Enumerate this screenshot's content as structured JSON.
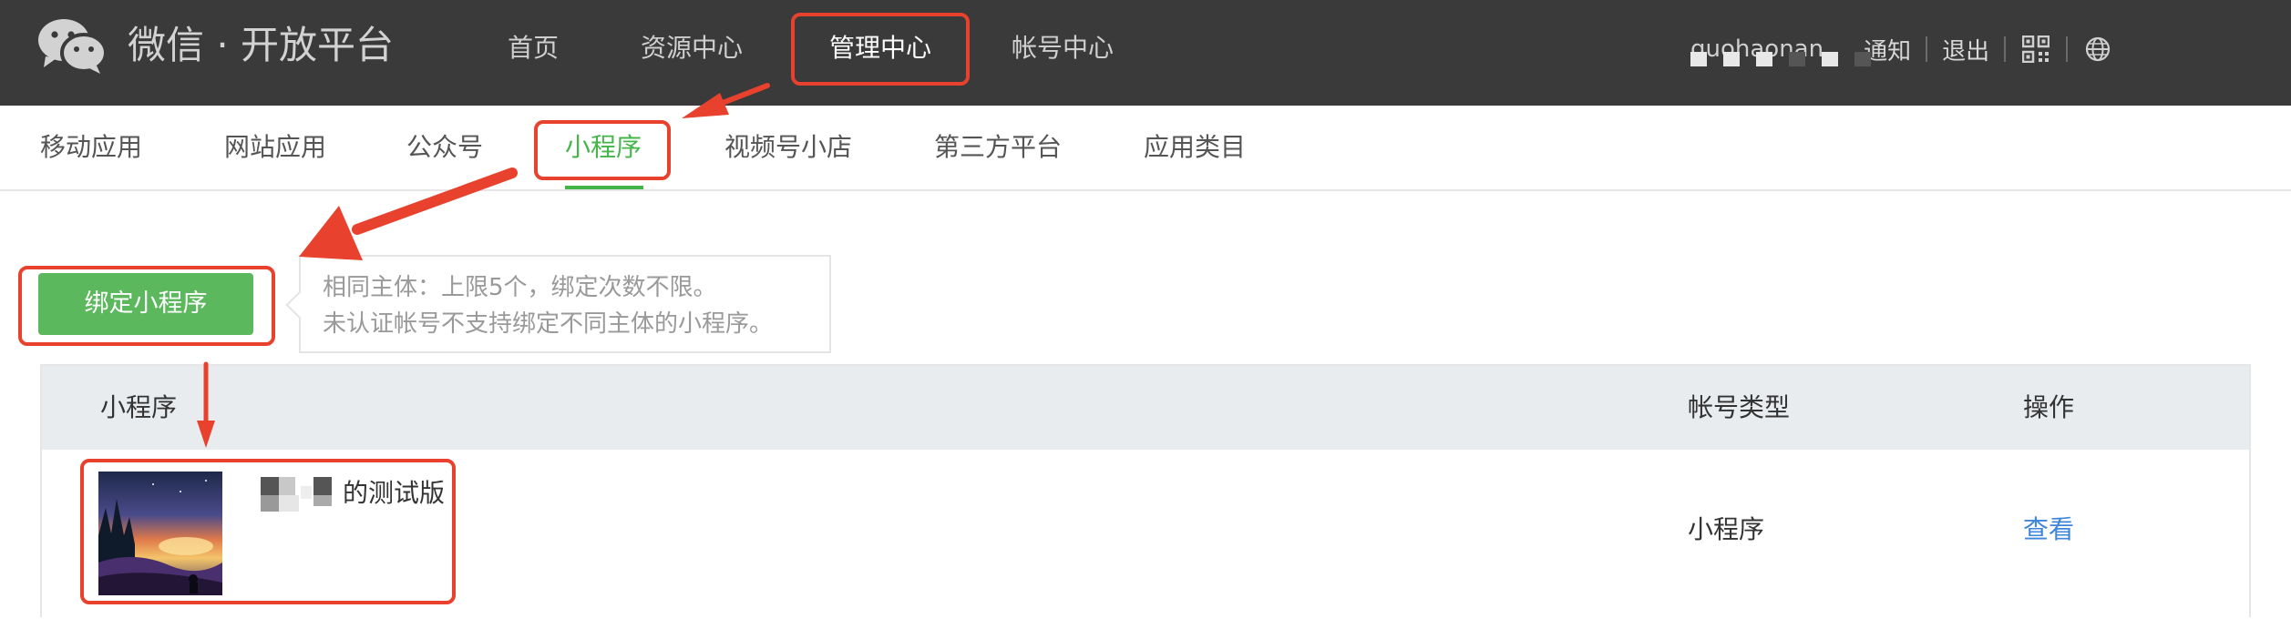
{
  "header": {
    "brand": "微信 · 开放平台",
    "nav": [
      "首页",
      "资源中心",
      "管理中心",
      "帐号中心"
    ],
    "active_nav": "管理中心",
    "username": "guohaonan",
    "links": {
      "notify": "通知",
      "logout": "退出"
    },
    "icons": [
      "wechat-logo-icon",
      "qrcode-icon",
      "globe-icon"
    ]
  },
  "subnav": {
    "items": [
      "移动应用",
      "网站应用",
      "公众号",
      "小程序",
      "视频号小店",
      "第三方平台",
      "应用类目"
    ],
    "active": "小程序"
  },
  "bind": {
    "button_label": "绑定小程序",
    "tip_lines": [
      "相同主体：上限5个，绑定次数不限。",
      "未认证帐号不支持绑定不同主体的小程序。"
    ]
  },
  "table": {
    "headers": [
      "小程序",
      "帐号类型",
      "操作"
    ],
    "rows": [
      {
        "name": "的测试版",
        "type": "小程序",
        "action": "查看"
      }
    ]
  },
  "colors": {
    "topbar": "#3a3a3b",
    "accent_green": "#44b549",
    "button_green": "#5cb85c",
    "link_blue": "#3e86d9",
    "annotation_red": "#e8412d"
  }
}
